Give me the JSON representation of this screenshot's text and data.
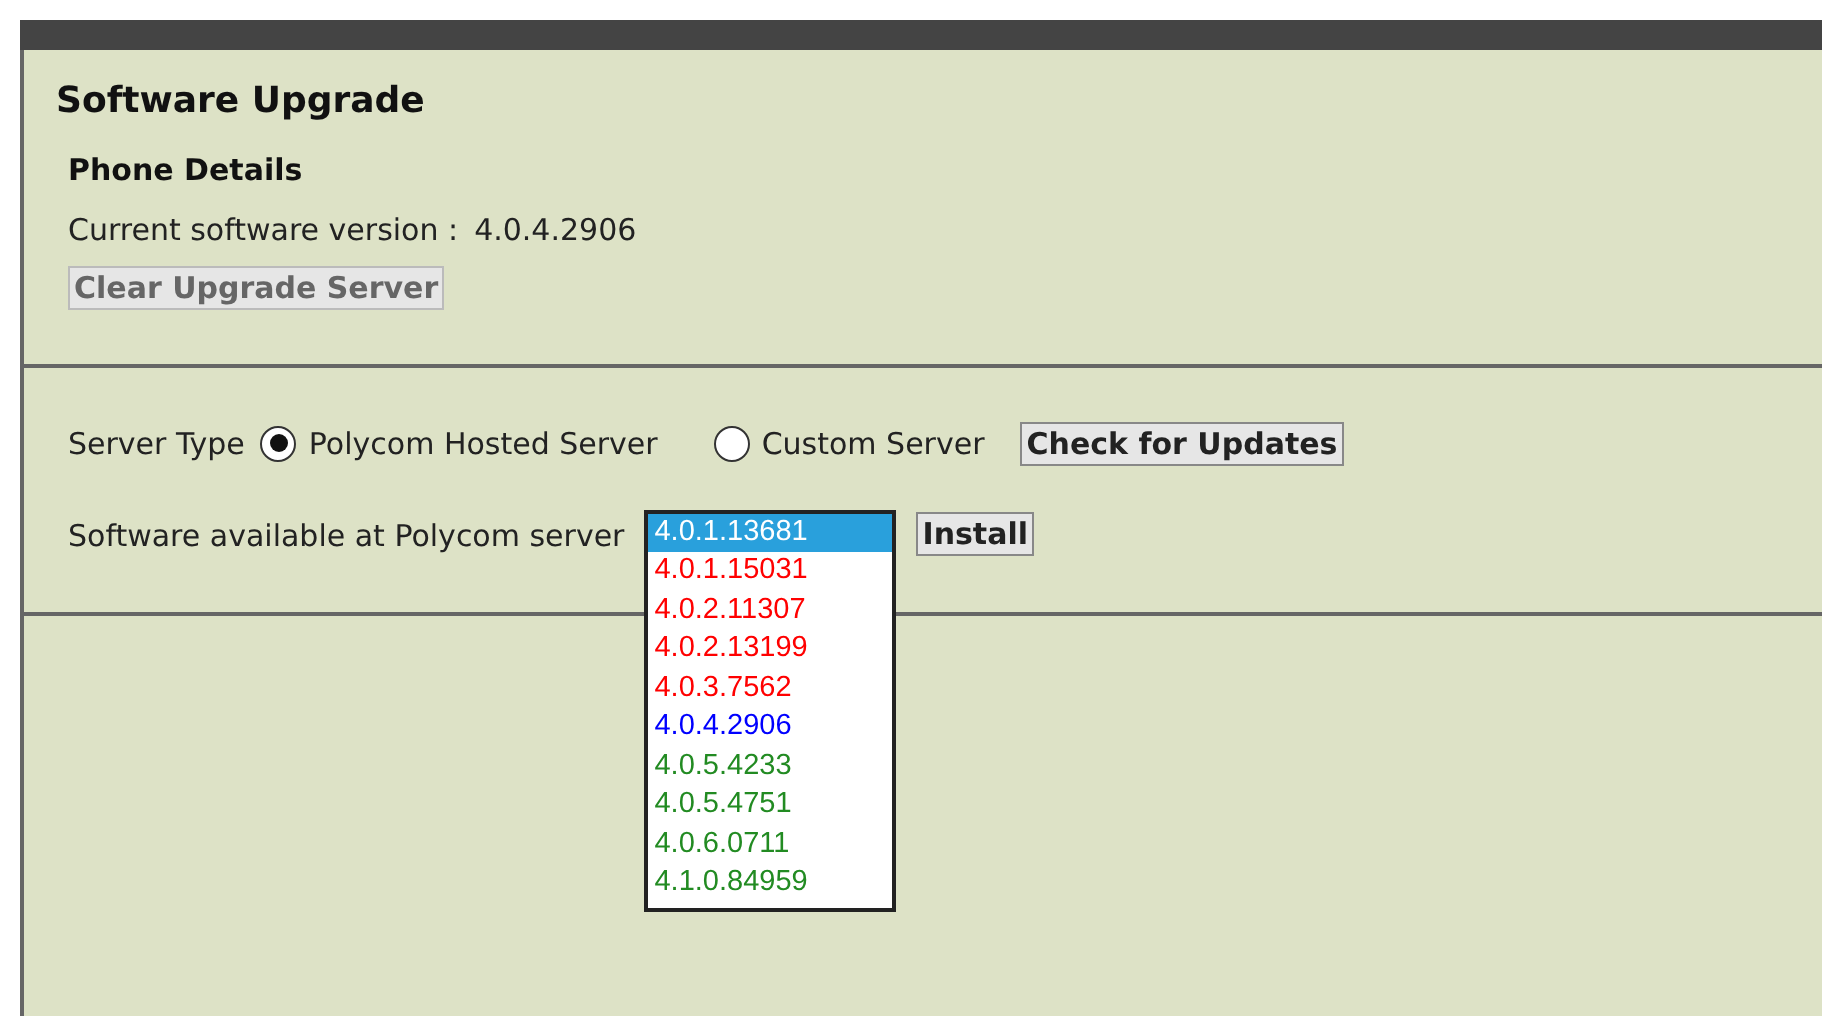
{
  "title": "Software Upgrade",
  "phone_details": {
    "heading": "Phone Details",
    "version_label": "Current software version :",
    "version": "4.0.4.2906",
    "clear_button": "Clear Upgrade Server"
  },
  "server_type": {
    "label": "Server Type",
    "options": [
      {
        "label": "Polycom Hosted Server",
        "selected": true
      },
      {
        "label": "Custom Server",
        "selected": false
      }
    ],
    "check_button": "Check for Updates"
  },
  "software": {
    "label": "Software available at Polycom server",
    "install_button": "Install",
    "versions": [
      {
        "label": "4.0.1.13681",
        "selected": true
      },
      {
        "label": "4.0.1.15031",
        "color": "#ff0000",
        "selected": false
      },
      {
        "label": "4.0.2.11307",
        "color": "#ff0000",
        "selected": false
      },
      {
        "label": "4.0.2.13199",
        "color": "#ff0000",
        "selected": false
      },
      {
        "label": "4.0.3.7562",
        "color": "#ff0000",
        "selected": false
      },
      {
        "label": "4.0.4.2906",
        "color": "#0000ff",
        "selected": false
      },
      {
        "label": "4.0.5.4233",
        "color": "#228b22",
        "selected": false
      },
      {
        "label": "4.0.5.4751",
        "color": "#228b22",
        "selected": false
      },
      {
        "label": "4.0.6.0711",
        "color": "#228b22",
        "selected": false
      },
      {
        "label": "4.1.0.84959",
        "color": "#228b22",
        "selected": false
      }
    ]
  }
}
